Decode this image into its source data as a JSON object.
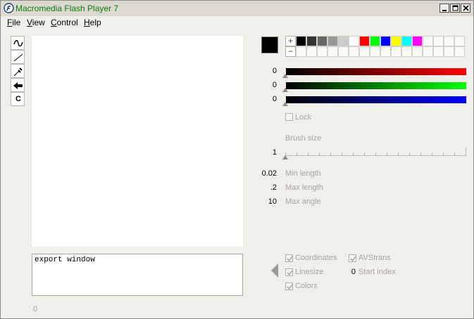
{
  "window": {
    "title": "Macromedia Flash Player 7"
  },
  "menu": [
    {
      "label": "File",
      "key": "F",
      "rest": "ile"
    },
    {
      "label": "View",
      "key": "V",
      "rest": "iew"
    },
    {
      "label": "Control",
      "key": "C",
      "rest": "ontrol"
    },
    {
      "label": "Help",
      "key": "H",
      "rest": "elp"
    }
  ],
  "tools": [
    "curve-icon",
    "line-icon",
    "eyedropper-icon",
    "back-arrow-icon",
    "clear-icon"
  ],
  "tool_clear_label": "C",
  "export": {
    "text": "export window",
    "counter": "0"
  },
  "color": {
    "current": "#000000",
    "palette": [
      "#000000",
      "#333333",
      "#666666",
      "#999999",
      "#cccccc",
      "#ffffff",
      "#ff0000",
      "#00ff00",
      "#0000ff",
      "#ffff00",
      "#00ffff",
      "#ff00ff"
    ],
    "plus": "+",
    "minus": "−",
    "red": "0",
    "green": "0",
    "blue": "0",
    "lock_label": "Lock"
  },
  "brush": {
    "label": "Brush size",
    "value": "1"
  },
  "params": [
    {
      "value": "0.02",
      "label": "Min length"
    },
    {
      "value": ".2",
      "label": "Max length"
    },
    {
      "value": "10",
      "label": "Max angle"
    }
  ],
  "export_options": {
    "coordinates": "Coordinates",
    "avstrans": "AVStrans",
    "linesize": "Linesize",
    "start_index_value": "0",
    "start_index_label": "Start index",
    "colors": "Colors"
  }
}
